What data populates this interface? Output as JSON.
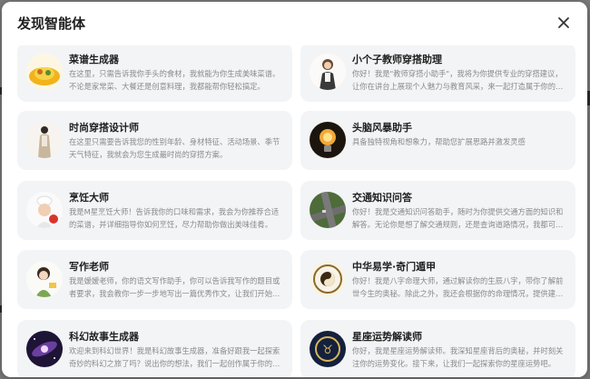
{
  "modal": {
    "title": "发现智能体",
    "close_icon": "close-icon"
  },
  "agents": [
    {
      "name": "菜谱生成器",
      "desc": "在这里，只需告诉我你手头的食材，我就能为你生成美味菜谱。不论是家常菜、大餐还是创意料理，我都能帮你轻松搞定。",
      "icon": "dish-icon"
    },
    {
      "name": "小个子教师穿搭助理",
      "desc": "你好！我是\"教师穿搭小助手\"，我将为你提供专业的穿搭建议，让你在讲台上展现个人魅力与教育风采，来一起打造属于你的风格吧。",
      "icon": "teacher-outfit-icon"
    },
    {
      "name": "时尚穿搭设计师",
      "desc": "在这里只需要告诉我您的性别年龄、身材特征、活动场景、季节天气特征，我就会为您生成最时尚的穿搭方案。",
      "icon": "fashion-icon"
    },
    {
      "name": "头脑风暴助手",
      "desc": "具备独特视角和想象力，帮助您扩展思路并激发灵感",
      "icon": "lightbulb-icon"
    },
    {
      "name": "烹饪大师",
      "desc": "我是M星烹饪大师！告诉我你的口味和需求，我会为你推荐合适的菜谱，并详细指导你如何烹饪，尽力帮助你做出美味佳肴。",
      "icon": "chef-icon"
    },
    {
      "name": "交通知识问答",
      "desc": "你好！我是交通知识问答助手，随时为你提供交通方面的知识和解答。无论你是想了解交通规则，还是查询道路情况，我都可以帮你。",
      "icon": "traffic-icon"
    },
    {
      "name": "写作老师",
      "desc": "我是嫒嫒老师，你的语文写作助手，你可以告诉我写作的题目或者要求，我会教你一步一步地写出一篇优秀作文，让我们开始吧。",
      "icon": "writing-teacher-icon"
    },
    {
      "name": "中华易学·奇门遁甲",
      "desc": "你好！我是八字命理大师，通过解读你的生辰八字，带你了解前世今生的奥秘。除此之外，我还会根据你的命理情况，提供建议。",
      "icon": "bagua-icon"
    },
    {
      "name": "科幻故事生成器",
      "desc": "欢迎来到科幻世界！我是科幻故事生成器，准备好跟我一起探索奇妙的科幻之旅了吗？说出你的想法，我们一起创作属于你的故事。",
      "icon": "galaxy-icon"
    },
    {
      "name": "星座运势解读师",
      "desc": "你好，我是星座运势解读师。我深知星座背后的奥秘，并时刻关注你的运势变化。接下来，让我们一起探索你的星座运势吧。",
      "icon": "zodiac-icon"
    }
  ],
  "colors": {
    "card_bg": "#f3f4f6",
    "title": "#1f1f1f",
    "desc": "#8a8a8a"
  }
}
